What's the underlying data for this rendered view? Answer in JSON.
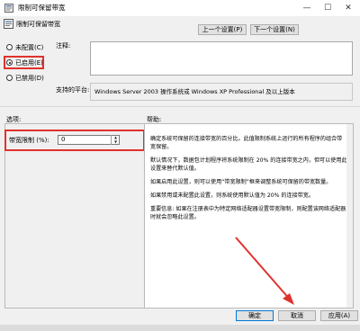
{
  "window": {
    "title": "限制可保留带宽",
    "close_glyph": "✕",
    "max_glyph": "☐",
    "min_glyph": "—"
  },
  "header": {
    "setting_name": "限制可保留带宽",
    "prev_button": "上一个设置(P)",
    "next_button": "下一个设置(N)"
  },
  "state": {
    "options": [
      {
        "label": "未配置(C)",
        "selected": false
      },
      {
        "label": "已启用(E)",
        "selected": true
      },
      {
        "label": "已禁用(D)",
        "selected": false
      }
    ]
  },
  "comment": {
    "label": "注释:",
    "value": ""
  },
  "platform": {
    "label": "支持的平台:",
    "value": "Windows Server 2003 操作系统或 Windows XP Professional 及以上版本"
  },
  "options_section": {
    "heading": "选项:",
    "bandwidth_label": "带宽限制 (%):",
    "bandwidth_value": "0"
  },
  "help_section": {
    "heading": "帮助:",
    "paragraphs": [
      "确定系统可保留的连接带宽的百分比。此值限制系统上运行的所有程序的组合带宽保留。",
      "默认情况下，数据包计划程序将系统限制在 20% 的连接带宽之内，但可以使用此设置来替代默认值。",
      "如果启用此设置，则可以使用“带宽限制”框来调整系统可保留的带宽数量。",
      "如果禁用或未配置此设置，则系统使用默认值为 20% 的连接带宽。",
      "重要信息: 如果在注册表中为特定网络适配器设置带宽限制，则配置该网络适配器时就会忽略此设置。"
    ]
  },
  "footer": {
    "ok": "确定",
    "cancel": "取消",
    "apply": "应用(A)"
  },
  "colors": {
    "highlight_red": "#e0312d",
    "window_bg": "#f0f0f0"
  }
}
